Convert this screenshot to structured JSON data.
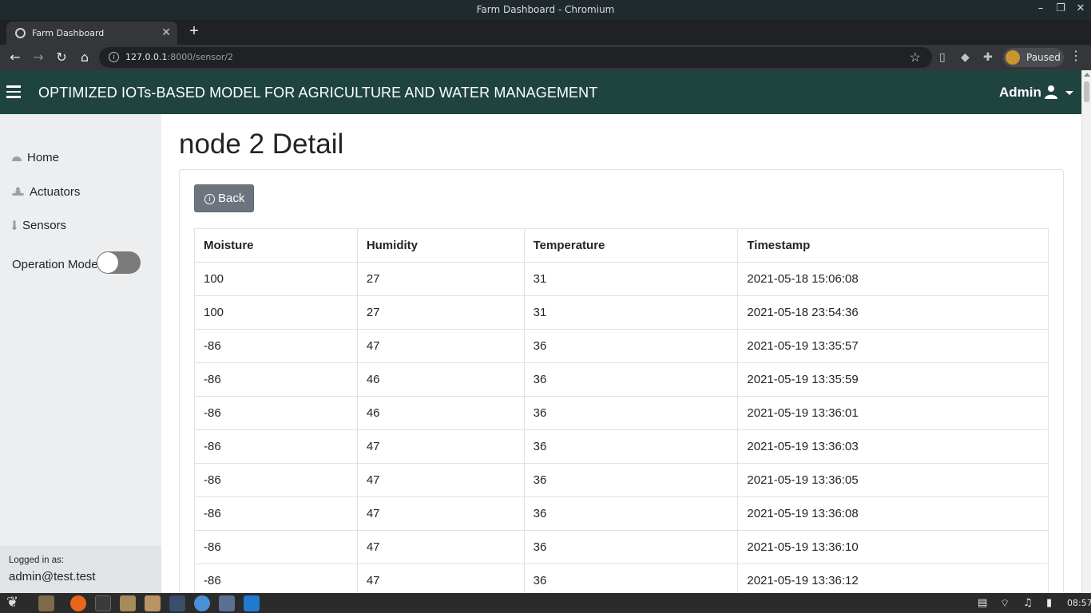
{
  "window": {
    "title": "Farm Dashboard - Chromium"
  },
  "browser": {
    "tab_title": "Farm Dashboard",
    "url_host": "127.0.0.1",
    "url_rest": ":8000/sensor/2",
    "profile_label": "Paused"
  },
  "header": {
    "title": "OPTIMIZED IOTs-BASED MODEL FOR AGRICULTURE AND WATER MANAGEMENT",
    "user": "Admin"
  },
  "sidebar": {
    "items": [
      {
        "label": "Home",
        "icon": "dashboard-icon"
      },
      {
        "label": "Actuators",
        "icon": "actuator-icon"
      },
      {
        "label": "Sensors",
        "icon": "thermometer-icon"
      }
    ],
    "operation_mode_label": "Operation Mode",
    "operation_mode_on": false,
    "logged_in_label": "Logged in as:",
    "logged_in_user": "admin@test.test"
  },
  "main": {
    "page_title": "node 2 Detail",
    "back_label": "Back",
    "table": {
      "columns": [
        "Moisture",
        "Humidity",
        "Temperature",
        "Timestamp"
      ],
      "rows": [
        [
          "100",
          "27",
          "31",
          "2021-05-18 15:06:08"
        ],
        [
          "100",
          "27",
          "31",
          "2021-05-18 23:54:36"
        ],
        [
          "-86",
          "47",
          "36",
          "2021-05-19 13:35:57"
        ],
        [
          "-86",
          "46",
          "36",
          "2021-05-19 13:35:59"
        ],
        [
          "-86",
          "46",
          "36",
          "2021-05-19 13:36:01"
        ],
        [
          "-86",
          "47",
          "36",
          "2021-05-19 13:36:03"
        ],
        [
          "-86",
          "47",
          "36",
          "2021-05-19 13:36:05"
        ],
        [
          "-86",
          "47",
          "36",
          "2021-05-19 13:36:08"
        ],
        [
          "-86",
          "47",
          "36",
          "2021-05-19 13:36:10"
        ],
        [
          "-86",
          "47",
          "36",
          "2021-05-19 13:36:12"
        ]
      ]
    }
  },
  "taskbar": {
    "clock": "08:57"
  },
  "colors": {
    "header_bg": "#1f4440",
    "sidebar_bg": "#eceef0",
    "button_secondary": "#6c757d",
    "table_border": "#dee2e6"
  }
}
